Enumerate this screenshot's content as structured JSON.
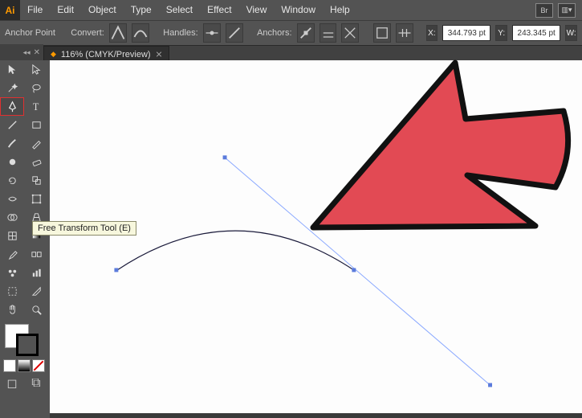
{
  "app": {
    "logo": "Ai"
  },
  "menu": [
    "File",
    "Edit",
    "Object",
    "Type",
    "Select",
    "Effect",
    "View",
    "Window",
    "Help"
  ],
  "menu_right": {
    "chip1": "Br",
    "chip2": "▥▾"
  },
  "controlbar": {
    "anchor_label": "Anchor Point",
    "convert_label": "Convert:",
    "handles_label": "Handles:",
    "anchors_label": "Anchors:",
    "x_label": "X:",
    "y_label": "Y:",
    "w_label": "W:",
    "x_value": "344.793 pt",
    "y_value": "243.345 pt"
  },
  "tab": {
    "title": "116% (CMYK/Preview)"
  },
  "tooltip": {
    "text": "Free Transform Tool (E)"
  },
  "tools_grid": [
    [
      "selection",
      "direct-selection"
    ],
    [
      "magic-wand",
      "lasso"
    ],
    [
      "pen",
      "type"
    ],
    [
      "line",
      "rectangle"
    ],
    [
      "paintbrush",
      "pencil"
    ],
    [
      "blob",
      "eraser"
    ],
    [
      "rotate",
      "scale"
    ],
    [
      "width",
      "free-transform"
    ],
    [
      "shape-builder",
      "perspective"
    ],
    [
      "mesh",
      "gradient"
    ],
    [
      "eyedropper",
      "blend"
    ],
    [
      "symbol",
      "graph"
    ],
    [
      "artboard",
      "slice"
    ],
    [
      "hand",
      "zoom"
    ]
  ],
  "selected_tool": "pen",
  "colors": {
    "arrow_fill": "#e24a54",
    "arrow_stroke": "#111111"
  }
}
